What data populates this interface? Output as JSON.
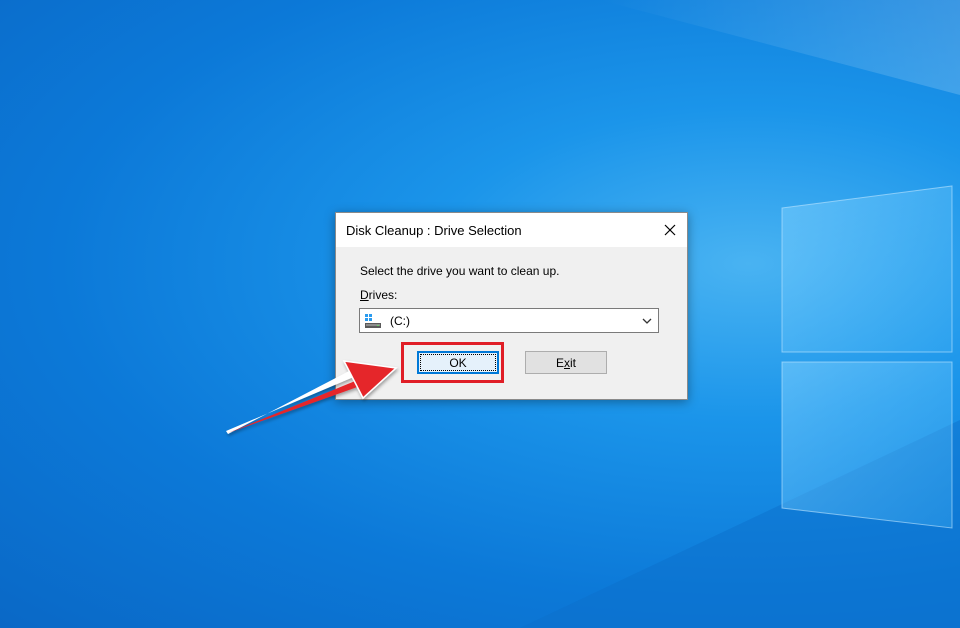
{
  "dialog": {
    "title": "Disk Cleanup : Drive Selection",
    "prompt": "Select the drive you want to clean up.",
    "drives_label_hotkey": "D",
    "drives_label_rest": "rives:",
    "selected_drive": "(C:)",
    "ok_label": "OK",
    "exit_label_pre": "E",
    "exit_label_hotkey": "x",
    "exit_label_post": "it"
  },
  "icons": {
    "close": "close-icon",
    "drive": "drive-icon",
    "dropdown": "chevron-down-icon"
  },
  "colors": {
    "highlight": "#e01e26",
    "desktop_blue": "#1b95ea",
    "focus_border": "#0078d7"
  }
}
